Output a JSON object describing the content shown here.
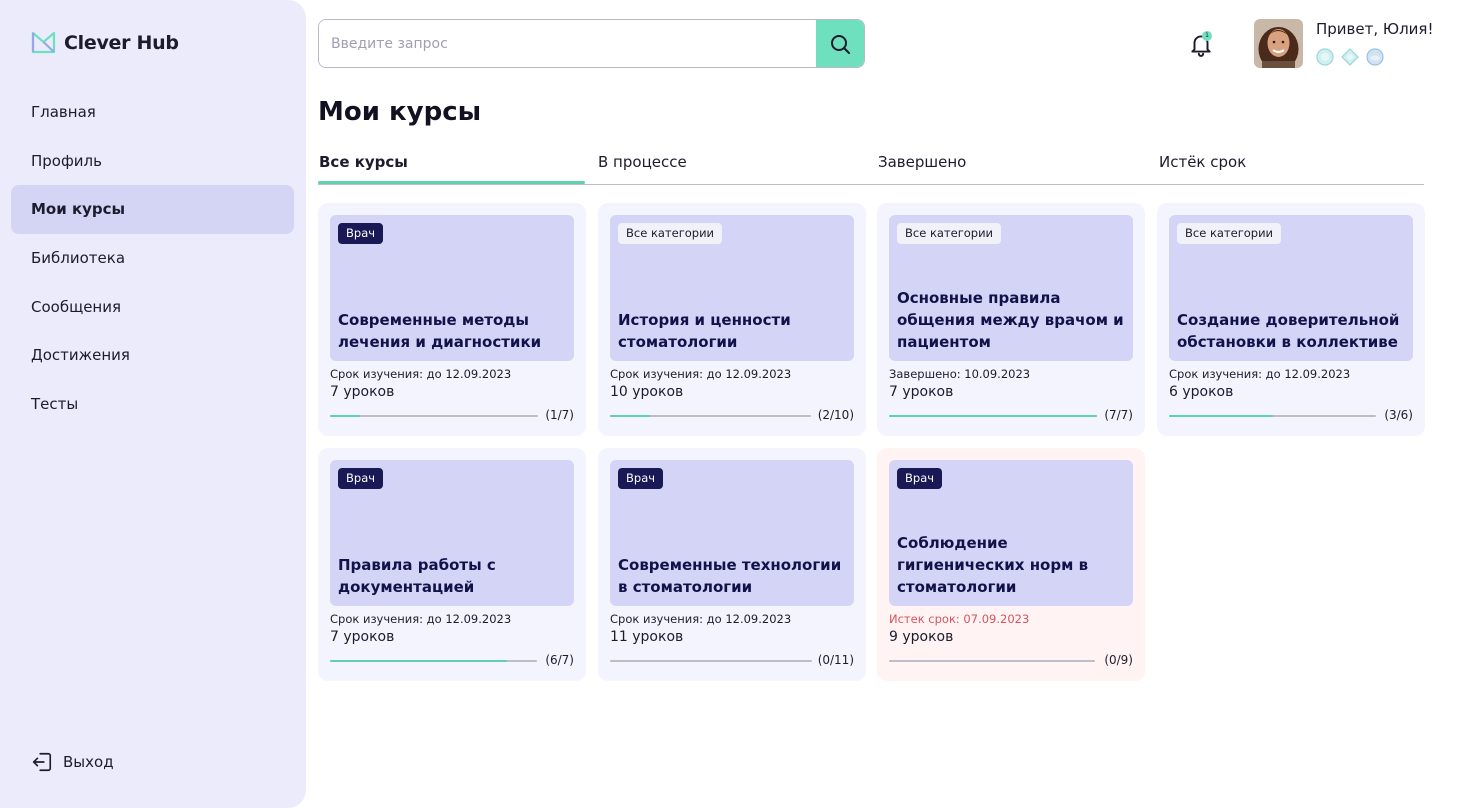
{
  "brand": {
    "name": "Clever Hub",
    "accent": "#6fe0bd",
    "navy": "#191955"
  },
  "sidebar": {
    "items": [
      {
        "label": "Главная"
      },
      {
        "label": "Профиль"
      },
      {
        "label": "Мои курсы",
        "active": true
      },
      {
        "label": "Библиотека"
      },
      {
        "label": "Сообщения"
      },
      {
        "label": "Достижения"
      },
      {
        "label": "Тесты"
      }
    ],
    "logout_label": "Выход"
  },
  "header": {
    "search_placeholder": "Введите запрос",
    "notifications_count": "1",
    "greeting": "Привет, Юлия!"
  },
  "main": {
    "title": "Мои курсы",
    "tabs": [
      {
        "label": "Все курсы",
        "active": true
      },
      {
        "label": "В процессе"
      },
      {
        "label": "Завершено"
      },
      {
        "label": "Истёк срок"
      }
    ],
    "courses": [
      {
        "category": "Врач",
        "title": "Современные методы лечения и диагностики",
        "deadline": "Срок изучения: до 12.09.2023",
        "lessons": "7 уроков",
        "progress_text": "(1/7)",
        "done": 1,
        "total": 7,
        "status": "active"
      },
      {
        "category": "Все категории",
        "title": "История и ценности стоматологии",
        "deadline": "Срок изучения: до 12.09.2023",
        "lessons": "10 уроков",
        "progress_text": "(2/10)",
        "done": 2,
        "total": 10,
        "status": "active"
      },
      {
        "category": "Все категории",
        "title": "Основные правила общения между врачом и пациентом",
        "deadline": "Завершено: 10.09.2023",
        "lessons": "7 уроков",
        "progress_text": "(7/7)",
        "done": 7,
        "total": 7,
        "status": "done"
      },
      {
        "category": "Все категории",
        "title": "Создание доверительной обстановки в коллективе",
        "deadline": "Срок изучения: до 12.09.2023",
        "lessons": "6 уроков",
        "progress_text": "(3/6)",
        "done": 3,
        "total": 6,
        "status": "active"
      },
      {
        "category": "Врач",
        "title": "Правила работы с документацией",
        "deadline": "Срок изучения: до 12.09.2023",
        "lessons": "7 уроков",
        "progress_text": "(6/7)",
        "done": 6,
        "total": 7,
        "status": "active"
      },
      {
        "category": "Врач",
        "title": "Современные технологии в стоматологии",
        "deadline": "Срок изучения: до 12.09.2023",
        "lessons": "11 уроков",
        "progress_text": "(0/11)",
        "done": 0,
        "total": 11,
        "status": "active"
      },
      {
        "category": "Врач",
        "title": "Соблюдение гигиенических норм в стоматологии",
        "deadline": "Истек срок: 07.09.2023",
        "lessons": "9 уроков",
        "progress_text": "(0/9)",
        "done": 0,
        "total": 9,
        "status": "expired"
      }
    ]
  }
}
